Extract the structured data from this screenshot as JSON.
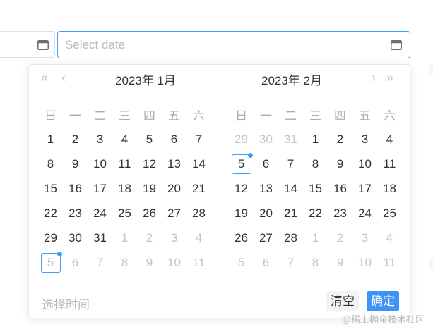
{
  "inputs": {
    "end_date": {
      "value": "",
      "placeholder": "Select date"
    }
  },
  "left_panel": {
    "title": "2023年 1月",
    "weekdays": [
      "日",
      "一",
      "二",
      "三",
      "四",
      "五",
      "六"
    ],
    "weeks": [
      [
        {
          "d": "1"
        },
        {
          "d": "2"
        },
        {
          "d": "3"
        },
        {
          "d": "4"
        },
        {
          "d": "5"
        },
        {
          "d": "6"
        },
        {
          "d": "7"
        }
      ],
      [
        {
          "d": "8"
        },
        {
          "d": "9"
        },
        {
          "d": "10"
        },
        {
          "d": "11"
        },
        {
          "d": "12"
        },
        {
          "d": "13"
        },
        {
          "d": "14"
        }
      ],
      [
        {
          "d": "15"
        },
        {
          "d": "16"
        },
        {
          "d": "17"
        },
        {
          "d": "18"
        },
        {
          "d": "19"
        },
        {
          "d": "20"
        },
        {
          "d": "21"
        }
      ],
      [
        {
          "d": "22"
        },
        {
          "d": "23"
        },
        {
          "d": "24"
        },
        {
          "d": "25"
        },
        {
          "d": "26"
        },
        {
          "d": "27"
        },
        {
          "d": "28"
        }
      ],
      [
        {
          "d": "29"
        },
        {
          "d": "30"
        },
        {
          "d": "31"
        },
        {
          "d": "1",
          "muted": true
        },
        {
          "d": "2",
          "muted": true
        },
        {
          "d": "3",
          "muted": true
        },
        {
          "d": "4",
          "muted": true
        }
      ],
      [
        {
          "d": "5",
          "muted": true,
          "today": true
        },
        {
          "d": "6",
          "muted": true
        },
        {
          "d": "7",
          "muted": true
        },
        {
          "d": "8",
          "muted": true
        },
        {
          "d": "9",
          "muted": true
        },
        {
          "d": "10",
          "muted": true
        },
        {
          "d": "11",
          "muted": true
        }
      ]
    ]
  },
  "right_panel": {
    "title": "2023年 2月",
    "weekdays": [
      "日",
      "一",
      "二",
      "三",
      "四",
      "五",
      "六"
    ],
    "weeks": [
      [
        {
          "d": "29",
          "muted": true
        },
        {
          "d": "30",
          "muted": true
        },
        {
          "d": "31",
          "muted": true
        },
        {
          "d": "1"
        },
        {
          "d": "2"
        },
        {
          "d": "3"
        },
        {
          "d": "4"
        }
      ],
      [
        {
          "d": "5",
          "today": true
        },
        {
          "d": "6"
        },
        {
          "d": "7"
        },
        {
          "d": "8"
        },
        {
          "d": "9"
        },
        {
          "d": "10"
        },
        {
          "d": "11"
        }
      ],
      [
        {
          "d": "12"
        },
        {
          "d": "13"
        },
        {
          "d": "14"
        },
        {
          "d": "15"
        },
        {
          "d": "16"
        },
        {
          "d": "17"
        },
        {
          "d": "18"
        }
      ],
      [
        {
          "d": "19"
        },
        {
          "d": "20"
        },
        {
          "d": "21"
        },
        {
          "d": "22"
        },
        {
          "d": "23"
        },
        {
          "d": "24"
        },
        {
          "d": "25"
        }
      ],
      [
        {
          "d": "26"
        },
        {
          "d": "27"
        },
        {
          "d": "28"
        },
        {
          "d": "1",
          "muted": true
        },
        {
          "d": "2",
          "muted": true
        },
        {
          "d": "3",
          "muted": true
        },
        {
          "d": "4",
          "muted": true
        }
      ],
      [
        {
          "d": "5",
          "muted": true
        },
        {
          "d": "6",
          "muted": true
        },
        {
          "d": "7",
          "muted": true
        },
        {
          "d": "8",
          "muted": true
        },
        {
          "d": "9",
          "muted": true
        },
        {
          "d": "10",
          "muted": true
        },
        {
          "d": "11",
          "muted": true
        }
      ]
    ]
  },
  "nav": {
    "prev_year": "«",
    "prev_month": "‹",
    "next_month": "›",
    "next_year": "»"
  },
  "footer": {
    "time_placeholder": "选择时间",
    "clear_label": "清空",
    "confirm_label": "确定"
  },
  "watermark": "@稀土掘金技术社区",
  "colors": {
    "accent": "#409eff",
    "confirm_bg": "#3c95f4",
    "muted_text": "#c0c4cc"
  },
  "icons": [
    "calendar-icon"
  ]
}
